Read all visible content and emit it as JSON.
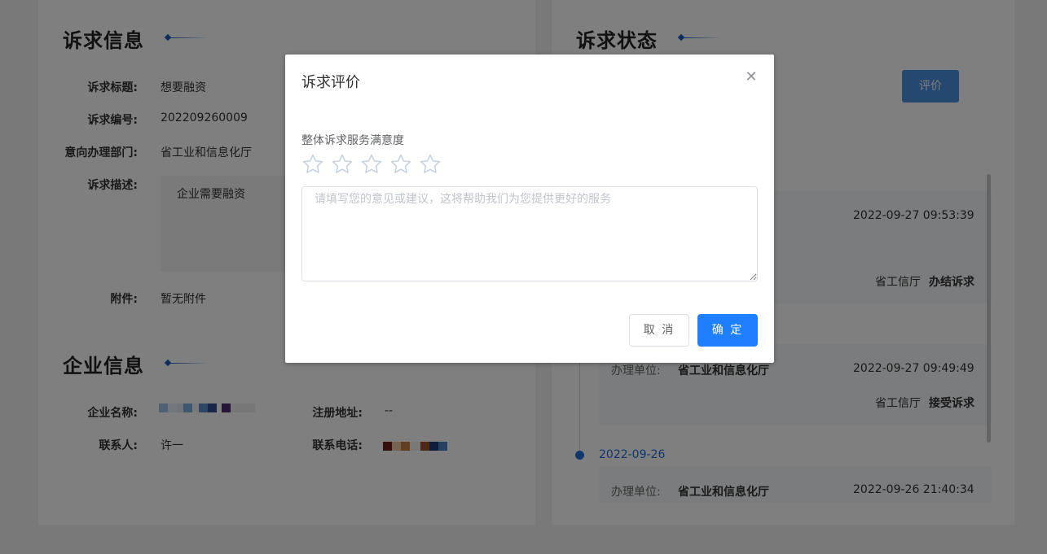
{
  "left_panel": {
    "appeal_title": "诉求信息",
    "fields": [
      {
        "label": "诉求标题:",
        "value": "想要融资"
      },
      {
        "label": "诉求编号:",
        "value": "202209260009"
      },
      {
        "label": "意向办理部门:",
        "value": "省工业和信息化厅"
      },
      {
        "label": "诉求描述:",
        "value": "企业需要融资"
      },
      {
        "label": "附件:",
        "value": "暂无附件"
      }
    ],
    "company_title": "企业信息",
    "company": {
      "name_label": "企业名称:",
      "address_label": "注册地址:",
      "address_value": "--",
      "contact_label": "联系人:",
      "contact_value": "许一",
      "phone_label": "联系电话:"
    }
  },
  "right_panel": {
    "status_title": "诉求状态",
    "evaluate_button": "评价",
    "timeline": [
      {
        "time": "2022-09-27 09:53:39",
        "dept": "省工信厅",
        "action": "办结诉求"
      },
      {
        "unit_label": "办理单位:",
        "unit": "省工业和信息化厅",
        "time": "2022-09-27 09:49:49",
        "dept": "省工信厅",
        "action": "接受诉求"
      }
    ],
    "date_node": "2022-09-26",
    "last_entry": {
      "unit_label": "办理单位:",
      "unit": "省工业和信息化厅",
      "time": "2022-09-26 21:40:34"
    }
  },
  "dialog": {
    "title": "诉求评价",
    "rating_label": "整体诉求服务满意度",
    "rating_value": 0,
    "rating_max": 5,
    "textarea_placeholder": "请填写您的意见或建议，这将帮助我们为您提供更好的服务",
    "textarea_value": "",
    "cancel_label": "取 消",
    "confirm_label": "确 定"
  },
  "colors": {
    "accent": "#1e7fff",
    "title_deco": "#1e5bb8",
    "timeline_date": "#1e6fd9",
    "overlay": "rgba(0,0,0,0.5)"
  }
}
